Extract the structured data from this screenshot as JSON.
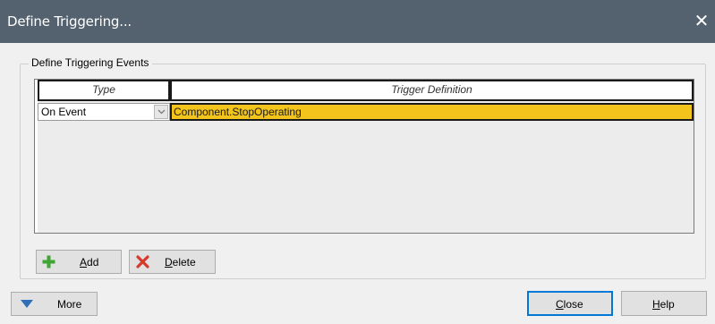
{
  "window": {
    "title": "Define Triggering...",
    "close_glyph": "✕"
  },
  "group": {
    "legend": "Define Triggering Events"
  },
  "grid": {
    "columns": [
      "Type",
      "Trigger Definition"
    ],
    "rows": [
      {
        "type": "On Event",
        "definition": "Component.StopOperating"
      }
    ]
  },
  "buttons": {
    "add_mnemonic": "A",
    "add_rest": "dd",
    "delete_mnemonic": "D",
    "delete_rest": "elete",
    "more": "More",
    "close_mnemonic": "C",
    "close_rest": "lose",
    "help_mnemonic": "H",
    "help_rest": "elp"
  },
  "icons": {
    "add": "plus-icon",
    "delete": "red-x-icon",
    "more": "triangle-down-icon",
    "dropdown": "chevron-down-icon"
  },
  "colors": {
    "titlebar": "#546270",
    "selected_cell": "#f2c41c",
    "add_icon": "#3fa535",
    "delete_icon": "#d63a2b",
    "more_icon": "#2f6fb8"
  }
}
